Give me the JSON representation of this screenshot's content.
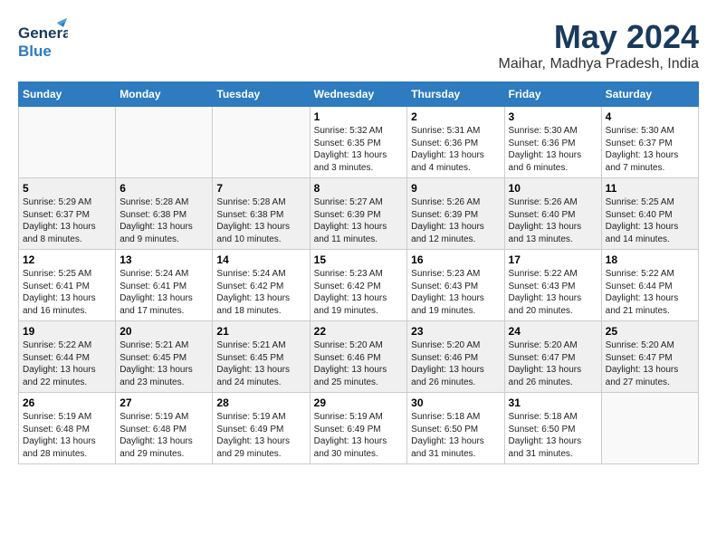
{
  "header": {
    "logo_line1": "General",
    "logo_line2": "Blue",
    "month": "May 2024",
    "location": "Maihar, Madhya Pradesh, India"
  },
  "days_of_week": [
    "Sunday",
    "Monday",
    "Tuesday",
    "Wednesday",
    "Thursday",
    "Friday",
    "Saturday"
  ],
  "weeks": [
    {
      "shaded": false,
      "days": [
        {
          "num": "",
          "info": ""
        },
        {
          "num": "",
          "info": ""
        },
        {
          "num": "",
          "info": ""
        },
        {
          "num": "1",
          "info": "Sunrise: 5:32 AM\nSunset: 6:35 PM\nDaylight: 13 hours and 3 minutes."
        },
        {
          "num": "2",
          "info": "Sunrise: 5:31 AM\nSunset: 6:36 PM\nDaylight: 13 hours and 4 minutes."
        },
        {
          "num": "3",
          "info": "Sunrise: 5:30 AM\nSunset: 6:36 PM\nDaylight: 13 hours and 6 minutes."
        },
        {
          "num": "4",
          "info": "Sunrise: 5:30 AM\nSunset: 6:37 PM\nDaylight: 13 hours and 7 minutes."
        }
      ]
    },
    {
      "shaded": true,
      "days": [
        {
          "num": "5",
          "info": "Sunrise: 5:29 AM\nSunset: 6:37 PM\nDaylight: 13 hours and 8 minutes."
        },
        {
          "num": "6",
          "info": "Sunrise: 5:28 AM\nSunset: 6:38 PM\nDaylight: 13 hours and 9 minutes."
        },
        {
          "num": "7",
          "info": "Sunrise: 5:28 AM\nSunset: 6:38 PM\nDaylight: 13 hours and 10 minutes."
        },
        {
          "num": "8",
          "info": "Sunrise: 5:27 AM\nSunset: 6:39 PM\nDaylight: 13 hours and 11 minutes."
        },
        {
          "num": "9",
          "info": "Sunrise: 5:26 AM\nSunset: 6:39 PM\nDaylight: 13 hours and 12 minutes."
        },
        {
          "num": "10",
          "info": "Sunrise: 5:26 AM\nSunset: 6:40 PM\nDaylight: 13 hours and 13 minutes."
        },
        {
          "num": "11",
          "info": "Sunrise: 5:25 AM\nSunset: 6:40 PM\nDaylight: 13 hours and 14 minutes."
        }
      ]
    },
    {
      "shaded": false,
      "days": [
        {
          "num": "12",
          "info": "Sunrise: 5:25 AM\nSunset: 6:41 PM\nDaylight: 13 hours and 16 minutes."
        },
        {
          "num": "13",
          "info": "Sunrise: 5:24 AM\nSunset: 6:41 PM\nDaylight: 13 hours and 17 minutes."
        },
        {
          "num": "14",
          "info": "Sunrise: 5:24 AM\nSunset: 6:42 PM\nDaylight: 13 hours and 18 minutes."
        },
        {
          "num": "15",
          "info": "Sunrise: 5:23 AM\nSunset: 6:42 PM\nDaylight: 13 hours and 19 minutes."
        },
        {
          "num": "16",
          "info": "Sunrise: 5:23 AM\nSunset: 6:43 PM\nDaylight: 13 hours and 19 minutes."
        },
        {
          "num": "17",
          "info": "Sunrise: 5:22 AM\nSunset: 6:43 PM\nDaylight: 13 hours and 20 minutes."
        },
        {
          "num": "18",
          "info": "Sunrise: 5:22 AM\nSunset: 6:44 PM\nDaylight: 13 hours and 21 minutes."
        }
      ]
    },
    {
      "shaded": true,
      "days": [
        {
          "num": "19",
          "info": "Sunrise: 5:22 AM\nSunset: 6:44 PM\nDaylight: 13 hours and 22 minutes."
        },
        {
          "num": "20",
          "info": "Sunrise: 5:21 AM\nSunset: 6:45 PM\nDaylight: 13 hours and 23 minutes."
        },
        {
          "num": "21",
          "info": "Sunrise: 5:21 AM\nSunset: 6:45 PM\nDaylight: 13 hours and 24 minutes."
        },
        {
          "num": "22",
          "info": "Sunrise: 5:20 AM\nSunset: 6:46 PM\nDaylight: 13 hours and 25 minutes."
        },
        {
          "num": "23",
          "info": "Sunrise: 5:20 AM\nSunset: 6:46 PM\nDaylight: 13 hours and 26 minutes."
        },
        {
          "num": "24",
          "info": "Sunrise: 5:20 AM\nSunset: 6:47 PM\nDaylight: 13 hours and 26 minutes."
        },
        {
          "num": "25",
          "info": "Sunrise: 5:20 AM\nSunset: 6:47 PM\nDaylight: 13 hours and 27 minutes."
        }
      ]
    },
    {
      "shaded": false,
      "days": [
        {
          "num": "26",
          "info": "Sunrise: 5:19 AM\nSunset: 6:48 PM\nDaylight: 13 hours and 28 minutes."
        },
        {
          "num": "27",
          "info": "Sunrise: 5:19 AM\nSunset: 6:48 PM\nDaylight: 13 hours and 29 minutes."
        },
        {
          "num": "28",
          "info": "Sunrise: 5:19 AM\nSunset: 6:49 PM\nDaylight: 13 hours and 29 minutes."
        },
        {
          "num": "29",
          "info": "Sunrise: 5:19 AM\nSunset: 6:49 PM\nDaylight: 13 hours and 30 minutes."
        },
        {
          "num": "30",
          "info": "Sunrise: 5:18 AM\nSunset: 6:50 PM\nDaylight: 13 hours and 31 minutes."
        },
        {
          "num": "31",
          "info": "Sunrise: 5:18 AM\nSunset: 6:50 PM\nDaylight: 13 hours and 31 minutes."
        },
        {
          "num": "",
          "info": ""
        }
      ]
    }
  ]
}
